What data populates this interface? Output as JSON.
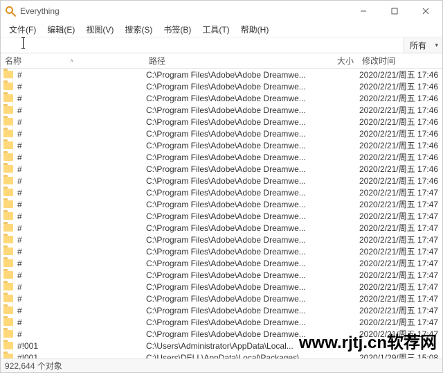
{
  "window": {
    "title": "Everything"
  },
  "menu": {
    "file": "文件(F)",
    "edit": "编辑(E)",
    "view": "视图(V)",
    "search": "搜索(S)",
    "bookmark": "书签(B)",
    "tools": "工具(T)",
    "help": "帮助(H)"
  },
  "search": {
    "value": "",
    "filter": "所有"
  },
  "columns": {
    "name": "名称",
    "path": "路径",
    "size": "大小",
    "date": "修改时间"
  },
  "rows": [
    {
      "name": "#",
      "path": "C:\\Program Files\\Adobe\\Adobe Dreamwe...",
      "date": "2020/2/21/周五 17:46"
    },
    {
      "name": "#",
      "path": "C:\\Program Files\\Adobe\\Adobe Dreamwe...",
      "date": "2020/2/21/周五 17:46"
    },
    {
      "name": "#",
      "path": "C:\\Program Files\\Adobe\\Adobe Dreamwe...",
      "date": "2020/2/21/周五 17:46"
    },
    {
      "name": "#",
      "path": "C:\\Program Files\\Adobe\\Adobe Dreamwe...",
      "date": "2020/2/21/周五 17:46"
    },
    {
      "name": "#",
      "path": "C:\\Program Files\\Adobe\\Adobe Dreamwe...",
      "date": "2020/2/21/周五 17:46"
    },
    {
      "name": "#",
      "path": "C:\\Program Files\\Adobe\\Adobe Dreamwe...",
      "date": "2020/2/21/周五 17:46"
    },
    {
      "name": "#",
      "path": "C:\\Program Files\\Adobe\\Adobe Dreamwe...",
      "date": "2020/2/21/周五 17:46"
    },
    {
      "name": "#",
      "path": "C:\\Program Files\\Adobe\\Adobe Dreamwe...",
      "date": "2020/2/21/周五 17:46"
    },
    {
      "name": "#",
      "path": "C:\\Program Files\\Adobe\\Adobe Dreamwe...",
      "date": "2020/2/21/周五 17:46"
    },
    {
      "name": "#",
      "path": "C:\\Program Files\\Adobe\\Adobe Dreamwe...",
      "date": "2020/2/21/周五 17:46"
    },
    {
      "name": "#",
      "path": "C:\\Program Files\\Adobe\\Adobe Dreamwe...",
      "date": "2020/2/21/周五 17:47"
    },
    {
      "name": "#",
      "path": "C:\\Program Files\\Adobe\\Adobe Dreamwe...",
      "date": "2020/2/21/周五 17:47"
    },
    {
      "name": "#",
      "path": "C:\\Program Files\\Adobe\\Adobe Dreamwe...",
      "date": "2020/2/21/周五 17:47"
    },
    {
      "name": "#",
      "path": "C:\\Program Files\\Adobe\\Adobe Dreamwe...",
      "date": "2020/2/21/周五 17:47"
    },
    {
      "name": "#",
      "path": "C:\\Program Files\\Adobe\\Adobe Dreamwe...",
      "date": "2020/2/21/周五 17:47"
    },
    {
      "name": "#",
      "path": "C:\\Program Files\\Adobe\\Adobe Dreamwe...",
      "date": "2020/2/21/周五 17:47"
    },
    {
      "name": "#",
      "path": "C:\\Program Files\\Adobe\\Adobe Dreamwe...",
      "date": "2020/2/21/周五 17:47"
    },
    {
      "name": "#",
      "path": "C:\\Program Files\\Adobe\\Adobe Dreamwe...",
      "date": "2020/2/21/周五 17:47"
    },
    {
      "name": "#",
      "path": "C:\\Program Files\\Adobe\\Adobe Dreamwe...",
      "date": "2020/2/21/周五 17:47"
    },
    {
      "name": "#",
      "path": "C:\\Program Files\\Adobe\\Adobe Dreamwe...",
      "date": "2020/2/21/周五 17:47"
    },
    {
      "name": "#",
      "path": "C:\\Program Files\\Adobe\\Adobe Dreamwe...",
      "date": "2020/2/21/周五 17:47"
    },
    {
      "name": "#",
      "path": "C:\\Program Files\\Adobe\\Adobe Dreamwe...",
      "date": "2020/2/21/周五 17:47"
    },
    {
      "name": "#",
      "path": "C:\\Program Files\\Adobe\\Adobe Dreamwe...",
      "date": "2020/2/21/周五 17:47"
    },
    {
      "name": "#!001",
      "path": "C:\\Users\\Administrator\\AppData\\Local...",
      "date": ""
    },
    {
      "name": "#!001",
      "path": "C:\\Users\\DELL\\AppData\\Local\\Packages\\...",
      "date": "2020/1/29/周三 15:08"
    }
  ],
  "status": "922,644 个对象",
  "watermark": "www.rjtj.cn软荐网"
}
